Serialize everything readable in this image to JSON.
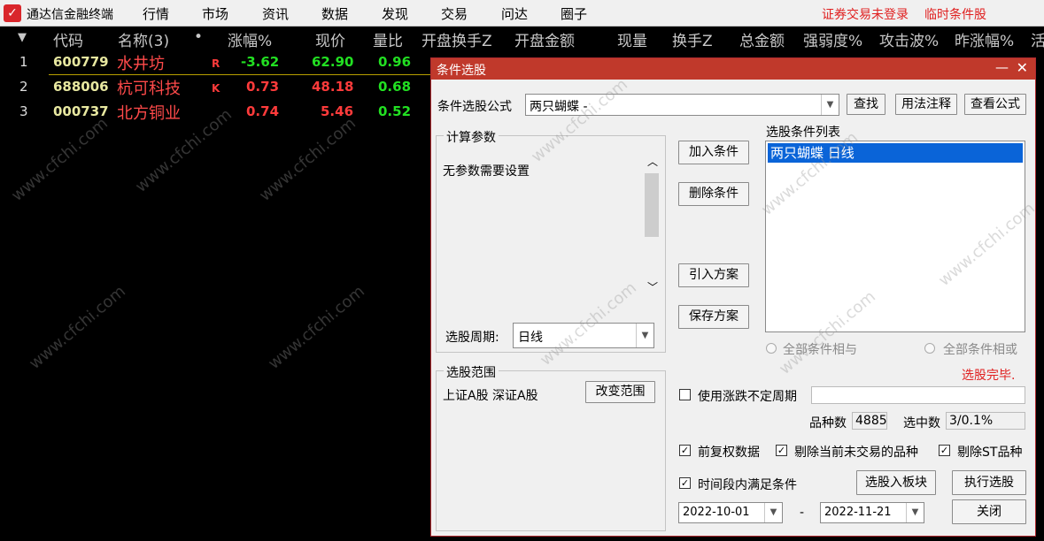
{
  "app": {
    "name": "通达信金融终端",
    "menu": [
      "行情",
      "市场",
      "资讯",
      "数据",
      "发现",
      "交易",
      "问达",
      "圈子"
    ],
    "status": [
      "证券交易未登录",
      "临时条件股"
    ]
  },
  "table": {
    "headers": [
      "▼",
      "代码",
      "名称(3)",
      "•",
      "涨幅%",
      "现价",
      "量比",
      "开盘换手Z",
      "开盘金额",
      "现量",
      "换手Z",
      "总金额",
      "强弱度%",
      "攻击波%",
      "昨涨幅%",
      "活"
    ],
    "rows": [
      {
        "idx": "1",
        "code": "600779",
        "name": "水井坊",
        "flag": "R",
        "change": "-3.62",
        "price": "62.90",
        "ratio": "0.96"
      },
      {
        "idx": "2",
        "code": "688006",
        "name": "杭可科技",
        "flag": "K",
        "change": "0.73",
        "price": "48.18",
        "ratio": "0.68"
      },
      {
        "idx": "3",
        "code": "000737",
        "name": "北方铜业",
        "flag": "",
        "change": "0.74",
        "price": "5.46",
        "ratio": "0.52"
      }
    ]
  },
  "dialog": {
    "title": "条件选股",
    "formula_label": "条件选股公式",
    "formula_value": "两只蝴蝶    -",
    "find_btn": "查找",
    "usage_btn": "用法注释",
    "view_formula_btn": "查看公式",
    "calc_params_title": "计算参数",
    "no_params": "无参数需要设置",
    "period_label": "选股周期:",
    "period_value": "日线",
    "range_title": "选股范围",
    "range_value": "上证A股 深证A股",
    "change_range_btn": "改变范围",
    "add_cond_btn": "加入条件",
    "del_cond_btn": "删除条件",
    "import_plan_btn": "引入方案",
    "save_plan_btn": "保存方案",
    "cond_list_title": "选股条件列表",
    "cond_list": [
      "两只蝴蝶  日线"
    ],
    "radio_and": "全部条件相与",
    "radio_or": "全部条件相或",
    "done_text": "选股完毕.",
    "uncertain_period": "使用涨跌不定周期",
    "variety_label": "品种数",
    "variety_value": "4885",
    "selected_label": "选中数",
    "selected_value": "3/0.1%",
    "chk_forward": "前复权数据",
    "chk_exclude_untraded": "剔除当前未交易的品种",
    "chk_exclude_st": "剔除ST品种",
    "chk_period": "时间段内满足条件",
    "to_block_btn": "选股入板块",
    "execute_btn": "执行选股",
    "close_btn": "关闭",
    "date_from": "2022-10-01",
    "date_dash": "-",
    "date_to": "2022-11-21"
  },
  "colors": {
    "up": "#ff3b3b",
    "down": "#22e022",
    "code": "#e8e8a0",
    "accent": "#c0392b"
  },
  "watermark": "www.cfchi.com"
}
